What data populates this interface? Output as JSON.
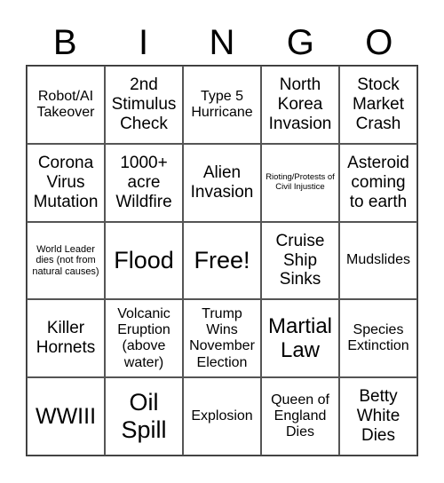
{
  "header": {
    "letters": [
      "B",
      "I",
      "N",
      "G",
      "O"
    ]
  },
  "board": {
    "cells": [
      "Robot/AI Takeover",
      "2nd Stimulus Check",
      "Type 5 Hurricane",
      "North Korea Invasion",
      "Stock Market Crash",
      "Corona Virus Mutation",
      "1000+ acre Wildfire",
      "Alien Invasion",
      "Rioting/Protests of Civil Injustice",
      "Asteroid coming to earth",
      "World Leader dies (not from natural causes)",
      "Flood",
      "Free!",
      "Cruise Ship Sinks",
      "Mudslides",
      "Killer Hornets",
      "Volcanic Eruption (above water)",
      "Trump Wins November Election",
      "Martial Law",
      "Species Extinction",
      "WWIII",
      "Oil Spill",
      "Explosion",
      "Queen of England Dies",
      "Betty White Dies"
    ],
    "free_index": 12
  }
}
